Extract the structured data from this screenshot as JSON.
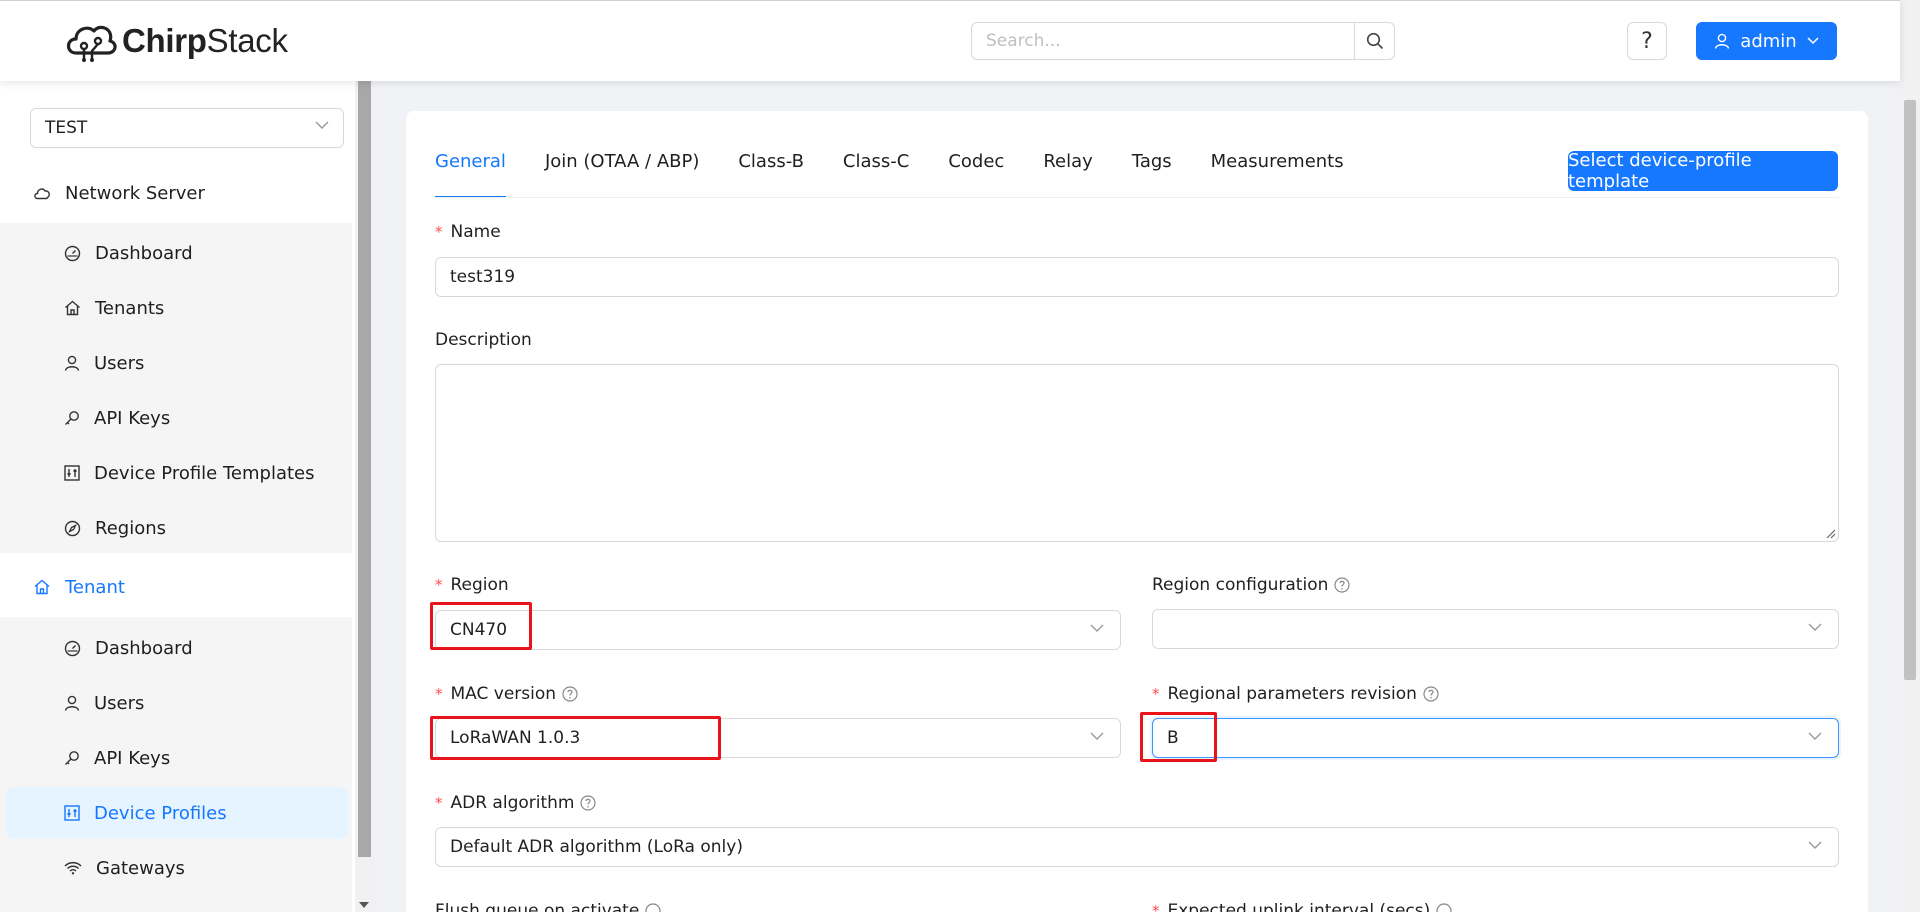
{
  "header": {
    "brand_bold": "Chirp",
    "brand_rest": "Stack",
    "search_placeholder": "Search...",
    "help_label": "?",
    "user_label": "admin"
  },
  "sidebar": {
    "tenant_select": "TEST",
    "network_server": {
      "label": "Network Server",
      "items": [
        "Dashboard",
        "Tenants",
        "Users",
        "API Keys",
        "Device Profile Templates",
        "Regions"
      ]
    },
    "tenant": {
      "label": "Tenant",
      "items": [
        "Dashboard",
        "Users",
        "API Keys",
        "Device Profiles",
        "Gateways"
      ]
    },
    "active_item": "Device Profiles"
  },
  "tabs": [
    "General",
    "Join (OTAA / ABP)",
    "Class-B",
    "Class-C",
    "Codec",
    "Relay",
    "Tags",
    "Measurements"
  ],
  "active_tab": "General",
  "template_button": "Select device-profile template",
  "form": {
    "name_label": "Name",
    "name_value": "test319",
    "description_label": "Description",
    "description_value": "",
    "region_label": "Region",
    "region_value": "CN470",
    "region_config_label": "Region configuration",
    "region_config_value": "",
    "mac_label": "MAC version",
    "mac_value": "LoRaWAN 1.0.3",
    "rp_label": "Regional parameters revision",
    "rp_value": "B",
    "adr_label": "ADR algorithm",
    "adr_value": "Default ADR algorithm (LoRa only)",
    "flush_label": "Flush queue on activate",
    "uplink_label": "Expected uplink interval (secs)"
  },
  "colors": {
    "primary": "#1677ff",
    "highlight_box": "#e8131b",
    "required": "#ff4d4f"
  }
}
